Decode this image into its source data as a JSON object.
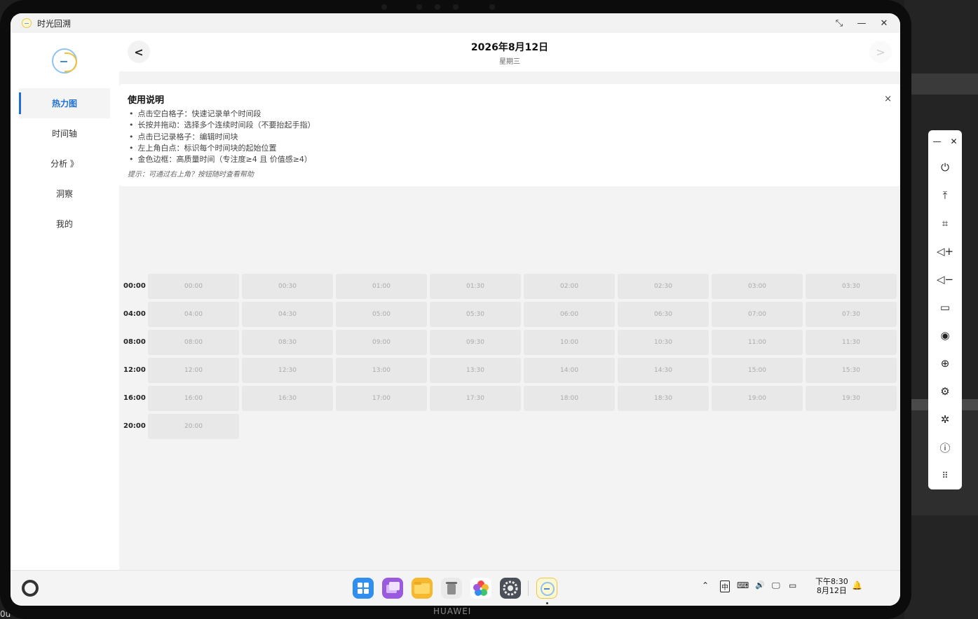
{
  "window": {
    "title": "时光回溯"
  },
  "sidebar": {
    "items": [
      {
        "label": "热力图"
      },
      {
        "label": "时间轴"
      },
      {
        "label": "分析 》"
      },
      {
        "label": "洞察"
      },
      {
        "label": "我的"
      }
    ]
  },
  "header": {
    "back_label": "<",
    "forward_label": ">",
    "date": "2026年8月12日",
    "weekday": "星期三"
  },
  "help": {
    "title": "使用说明",
    "close_label": "×",
    "items": [
      "点击空白格子：快速记录单个时间段",
      "长按并拖动：选择多个连续时间段（不要抬起手指）",
      "点击已记录格子：编辑时间块",
      "左上角白点：标识每个时间块的起始位置",
      "金色边框：高质量时间（专注度≥4 且 价值感≥4）"
    ],
    "hint": "提示：可通过右上角？按钮随时查看帮助"
  },
  "heatmap": {
    "rows": [
      {
        "label": "00:00",
        "cells": [
          "00:00",
          "00:30",
          "01:00",
          "01:30",
          "02:00",
          "02:30",
          "03:00",
          "03:30"
        ]
      },
      {
        "label": "04:00",
        "cells": [
          "04:00",
          "04:30",
          "05:00",
          "05:30",
          "06:00",
          "06:30",
          "07:00",
          "07:30"
        ]
      },
      {
        "label": "08:00",
        "cells": [
          "08:00",
          "08:30",
          "09:00",
          "09:30",
          "10:00",
          "10:30",
          "11:00",
          "11:30"
        ]
      },
      {
        "label": "12:00",
        "cells": [
          "12:00",
          "12:30",
          "13:00",
          "13:30",
          "14:00",
          "14:30",
          "15:00",
          "15:30"
        ]
      },
      {
        "label": "16:00",
        "cells": [
          "16:00",
          "16:30",
          "17:00",
          "17:30",
          "18:00",
          "18:30",
          "19:00",
          "19:30"
        ]
      },
      {
        "label": "20:00",
        "cells": [
          "20:00"
        ]
      }
    ]
  },
  "taskbar": {
    "apps": [
      "app-grid-icon",
      "multitask-icon",
      "files-icon",
      "trash-icon",
      "gallery-icon",
      "settings-icon",
      "time-recall-icon"
    ],
    "tray": {
      "ime": "中",
      "keyboard": "⌨",
      "volume": "🔊",
      "battery": "▭"
    },
    "clock_time": "下午8:30",
    "clock_date": "8月12日"
  },
  "device": {
    "brand": "HUAWEI"
  },
  "background": {
    "text": "0u"
  },
  "control_panel": {
    "icons": [
      "power-icon",
      "upload-icon",
      "crop-icon",
      "volume-up-icon",
      "volume-down-icon",
      "battery-icon",
      "broadcast-icon",
      "globe-icon",
      "settings-icon",
      "bug-icon",
      "info-icon",
      "keyboard-icon"
    ]
  },
  "colors": {
    "accent": "#1f6fd6",
    "cell": "#e8e8e8",
    "background": "#f3f3f3"
  }
}
